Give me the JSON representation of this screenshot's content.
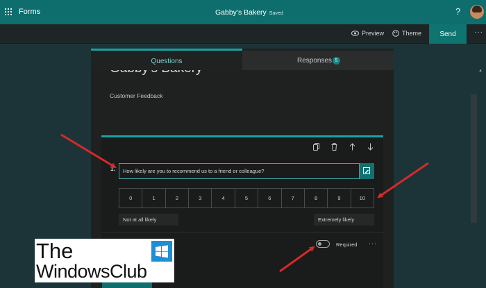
{
  "header": {
    "app_name": "Forms",
    "doc_title": "Gabby's Bakery",
    "save_status": "Saved",
    "help_symbol": "?"
  },
  "toolbar": {
    "preview_label": "Preview",
    "theme_label": "Theme",
    "send_label": "Send",
    "more_symbol": "···"
  },
  "tabs": {
    "questions_label": "Questions",
    "responses_label": "Responses",
    "responses_count": "5"
  },
  "form": {
    "title": "Gabby's Bakery",
    "subtitle": "Customer Feedback"
  },
  "question": {
    "number": "1.",
    "text": "How likely are you to recommend us to a friend or colleague?",
    "scale": [
      "0",
      "1",
      "2",
      "3",
      "4",
      "5",
      "6",
      "7",
      "8",
      "9",
      "10"
    ],
    "low_label": "Not at all likely",
    "high_label": "Extremely likely",
    "required_label": "Required",
    "required_on": false,
    "more_symbol": "···"
  },
  "watermark": {
    "line1": "The",
    "line2": "WindowsClub"
  },
  "colors": {
    "accent": "#17a3a3",
    "topbar": "#0e6e6e",
    "background": "#1c3438",
    "annotation_arrow": "#d42a2a"
  }
}
